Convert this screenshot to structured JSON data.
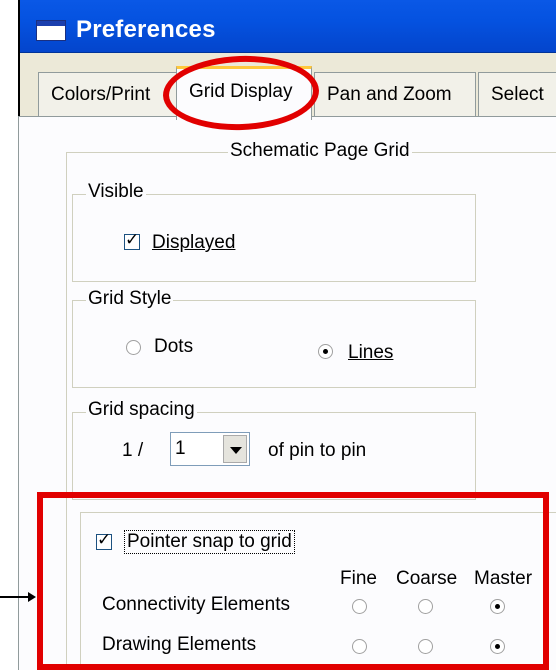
{
  "window": {
    "title": "Preferences"
  },
  "tabs": [
    {
      "label": "Colors/Print",
      "active": false
    },
    {
      "label": "Grid Display",
      "active": true
    },
    {
      "label": "Pan and Zoom",
      "active": false
    },
    {
      "label": "Select",
      "active": false
    }
  ],
  "schematic_grid": {
    "legend": "Schematic Page Grid",
    "visible": {
      "legend": "Visible",
      "displayed_label": "Displayed",
      "displayed_checked": true
    },
    "grid_style": {
      "legend": "Grid Style",
      "options": [
        {
          "label": "Dots",
          "selected": false
        },
        {
          "label": "Lines",
          "selected": true
        }
      ]
    },
    "grid_spacing": {
      "legend": "Grid spacing",
      "prefix": "1 /",
      "value": "1",
      "suffix": "of pin to pin"
    },
    "pointer_snap": {
      "label": "Pointer snap to grid",
      "checked": true
    },
    "snap_columns": [
      "Fine",
      "Coarse",
      "Master"
    ],
    "snap_rows": [
      {
        "label": "Connectivity Elements",
        "selected": "Master"
      },
      {
        "label": "Drawing Elements",
        "selected": "Master"
      }
    ]
  },
  "annotations": {
    "highlight_color": "#e10000"
  },
  "colors": {
    "titlebar": "#0552e0",
    "panel": "#fcfcfe",
    "dialog": "#ece9d8",
    "tab_accent": "#ffc83c"
  }
}
